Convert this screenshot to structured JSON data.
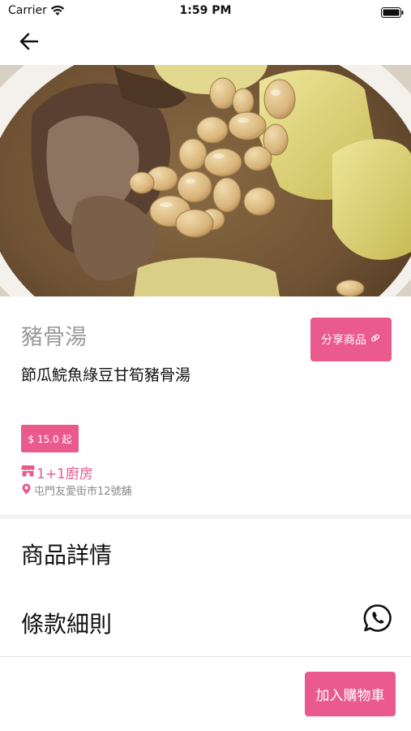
{
  "status_bar": {
    "carrier": "Carrier",
    "time": "1:59 PM",
    "wifi_icon": "wifi-icon",
    "battery_icon": "battery-icon"
  },
  "nav": {
    "back_icon": "arrow-left-icon"
  },
  "hero": {
    "image": "pork-bone-soup-photo",
    "carousel_active_index": 1,
    "carousel_count": 1
  },
  "product": {
    "category": "豬骨湯",
    "name": "節瓜鯇魚綠豆甘筍豬骨湯",
    "price": "$ 15.0 起",
    "share_label": "分享商品",
    "share_icon": "link-icon",
    "shop_name": "1+1廚房",
    "shop_icon": "store-icon",
    "address": "屯門友愛街市12號舖",
    "address_icon": "location-pin-icon"
  },
  "sections": {
    "details_label": "商品詳情",
    "terms_label": "條款細則",
    "whatsapp_icon": "whatsapp-icon"
  },
  "actions": {
    "add_to_cart_label": "加入購物車"
  },
  "colors": {
    "accent": "#ea5a8c",
    "muted_text": "#9a9a9a",
    "divider": "#f3f3f3"
  }
}
